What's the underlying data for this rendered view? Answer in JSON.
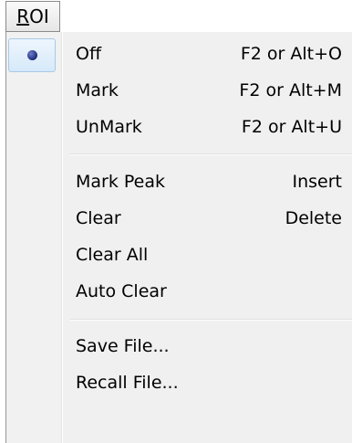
{
  "menubar": {
    "roi_label_mnemonic": "R",
    "roi_label_rest": "OI"
  },
  "menu": {
    "groups": [
      [
        {
          "label": "Off",
          "shortcut": "F2 or Alt+O",
          "checked": true
        },
        {
          "label": "Mark",
          "shortcut": "F2 or Alt+M"
        },
        {
          "label": "UnMark",
          "shortcut": "F2 or Alt+U"
        }
      ],
      [
        {
          "label": "Mark Peak",
          "shortcut": "Insert"
        },
        {
          "label": "Clear",
          "shortcut": "Delete"
        },
        {
          "label": "Clear All",
          "shortcut": ""
        },
        {
          "label": "Auto Clear",
          "shortcut": ""
        }
      ],
      [
        {
          "label": "Save File...",
          "shortcut": ""
        },
        {
          "label": "Recall File...",
          "shortcut": ""
        }
      ]
    ]
  },
  "icons": {
    "checked_marker": "radio-dot-icon"
  },
  "colors": {
    "radio_dot": "#1c2a7a",
    "check_highlight": "#d6e9f9",
    "menu_background": "#f0f0f0"
  }
}
